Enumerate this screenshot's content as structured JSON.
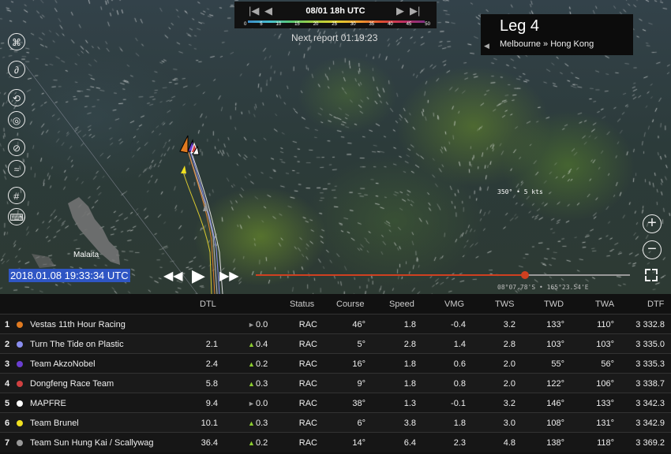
{
  "timebar": {
    "date": "08/01 18h UTC",
    "scale_labels": [
      "0",
      "5",
      "10",
      "15",
      "20",
      "25",
      "30",
      "35",
      "40",
      "45",
      "50"
    ]
  },
  "next_report": "Next report 01:19:23",
  "leg": {
    "title": "Leg 4",
    "route": "Melbourne » Hong Kong"
  },
  "map": {
    "island_label": "Malaita",
    "readout": "350° • 5 kts",
    "coordinate": "08°07.78'S • 165°23.54'E"
  },
  "clock": "2018.01.08 19:33:34 UTC",
  "playback": {
    "progress": 0.72
  },
  "toolbar": [
    "layers-icon",
    "route-icon",
    "wind-icon",
    "camera-icon",
    "compass-icon",
    "wave-icon",
    "grid-icon",
    "keyboard-icon"
  ],
  "table": {
    "headers": {
      "dtl": "DTL",
      "status": "Status",
      "course": "Course",
      "speed": "Speed",
      "vmg": "VMG",
      "tws": "TWS",
      "twd": "TWD",
      "twa": "TWA",
      "dtf": "DTF"
    },
    "rows": [
      {
        "rank": "1",
        "color": "#e07a20",
        "name": "Vestas 11th Hour Racing",
        "dtl": "",
        "trend": "►",
        "change": "0.0",
        "status": "RAC",
        "course": "46°",
        "speed": "1.8",
        "vmg": "-0.4",
        "tws": "3.2",
        "twd": "133°",
        "twa": "110°",
        "dtf": "3 332.8"
      },
      {
        "rank": "2",
        "color": "#8a8ef0",
        "name": "Turn The Tide on Plastic",
        "dtl": "2.1",
        "trend": "▲",
        "change": "0.4",
        "status": "RAC",
        "course": "5°",
        "speed": "2.8",
        "vmg": "1.4",
        "tws": "2.8",
        "twd": "103°",
        "twa": "103°",
        "dtf": "3 335.0"
      },
      {
        "rank": "3",
        "color": "#6a3ed0",
        "name": "Team AkzoNobel",
        "dtl": "2.4",
        "trend": "▲",
        "change": "0.2",
        "status": "RAC",
        "course": "16°",
        "speed": "1.8",
        "vmg": "0.6",
        "tws": "2.0",
        "twd": "55°",
        "twa": "56°",
        "dtf": "3 335.3"
      },
      {
        "rank": "4",
        "color": "#d04040",
        "name": "Dongfeng Race Team",
        "dtl": "5.8",
        "trend": "▲",
        "change": "0.3",
        "status": "RAC",
        "course": "9°",
        "speed": "1.8",
        "vmg": "0.8",
        "tws": "2.0",
        "twd": "122°",
        "twa": "106°",
        "dtf": "3 338.7"
      },
      {
        "rank": "5",
        "color": "#ffffff",
        "name": "MAPFRE",
        "dtl": "9.4",
        "trend": "►",
        "change": "0.0",
        "status": "RAC",
        "course": "38°",
        "speed": "1.3",
        "vmg": "-0.1",
        "tws": "3.2",
        "twd": "146°",
        "twa": "133°",
        "dtf": "3 342.3"
      },
      {
        "rank": "6",
        "color": "#f0e020",
        "name": "Team Brunel",
        "dtl": "10.1",
        "trend": "▲",
        "change": "0.3",
        "status": "RAC",
        "course": "6°",
        "speed": "3.8",
        "vmg": "1.8",
        "tws": "3.0",
        "twd": "108°",
        "twa": "131°",
        "dtf": "3 342.9"
      },
      {
        "rank": "7",
        "color": "#999999",
        "name": "Team Sun Hung Kai / Scallywag",
        "dtl": "36.4",
        "trend": "▲",
        "change": "0.2",
        "status": "RAC",
        "course": "14°",
        "speed": "6.4",
        "vmg": "2.3",
        "tws": "4.8",
        "twd": "138°",
        "twa": "118°",
        "dtf": "3 369.2"
      }
    ]
  }
}
